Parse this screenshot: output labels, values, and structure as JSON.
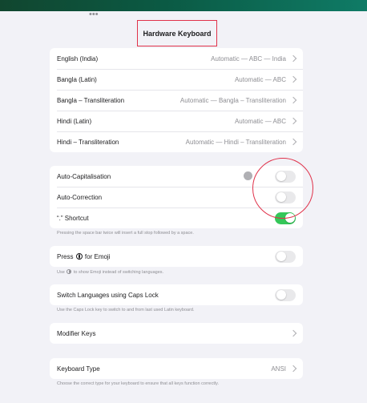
{
  "header": {
    "title": "Hardware Keyboard"
  },
  "keyboards": [
    {
      "name": "English (India)",
      "value": "Automatic — ABC — India"
    },
    {
      "name": "Bangla (Latin)",
      "value": "Automatic — ABC"
    },
    {
      "name": "Bangla – Transliteration",
      "value": "Automatic — Bangla – Transliteration"
    },
    {
      "name": "Hindi (Latin)",
      "value": "Automatic — ABC"
    },
    {
      "name": "Hindi – Transliteration",
      "value": "Automatic — Hindi – Transliteration"
    }
  ],
  "typing": {
    "auto_capitalisation": {
      "label": "Auto-Capitalisation",
      "on": false
    },
    "auto_correction": {
      "label": "Auto-Correction",
      "on": false
    },
    "shortcut": {
      "label": "“.” Shortcut",
      "on": true
    },
    "footnote": "Pressing the space bar twice will insert a full stop followed by a space."
  },
  "emoji": {
    "label_before": "Press",
    "label_after": "for Emoji",
    "on": false,
    "footnote_before": "Use",
    "footnote_after": "to show Emoji instead of switching languages."
  },
  "caps_lock": {
    "label": "Switch Languages using Caps Lock",
    "on": false,
    "footnote": "Use the Caps Lock key to switch to and from last used Latin keyboard."
  },
  "modifier_keys": {
    "label": "Modifier Keys"
  },
  "keyboard_type": {
    "label": "Keyboard Type",
    "value": "ANSI",
    "footnote": "Choose the correct type for your keyboard to ensure that all keys function correctly."
  },
  "colors": {
    "toggle_on": "#34c759",
    "annotation": "#e0324a",
    "top_bar": "#0b5a44"
  },
  "icons": {
    "more": "ellipsis-icon",
    "globe": "globe-icon",
    "chevron": "chevron-right-icon"
  }
}
